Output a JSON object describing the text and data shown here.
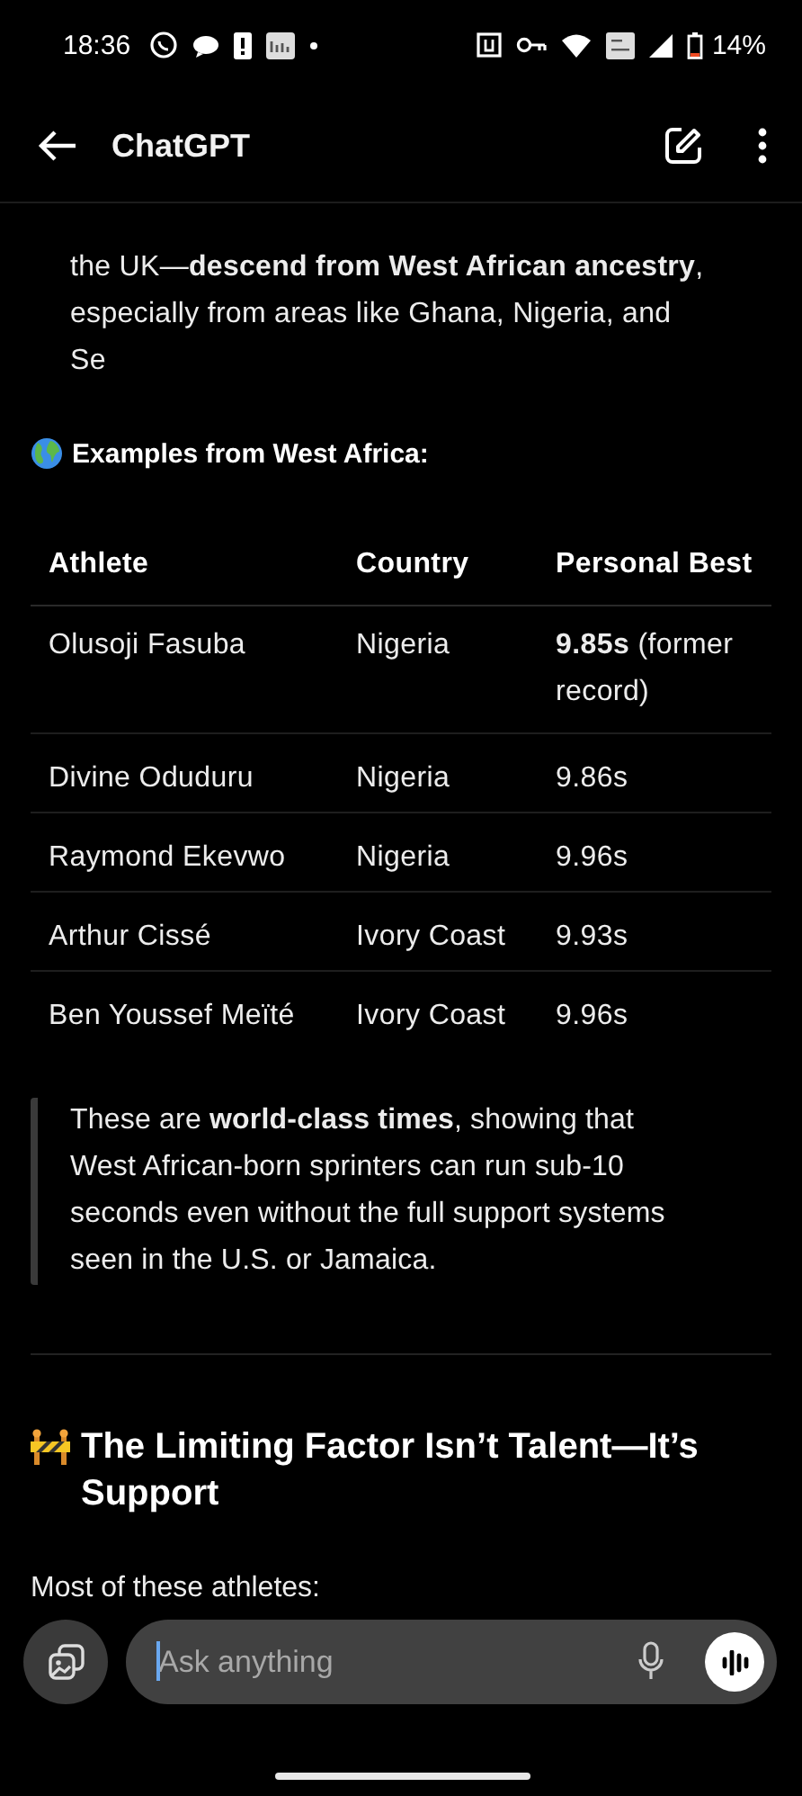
{
  "status_bar": {
    "time": "18:36",
    "battery": "14%"
  },
  "header": {
    "title": "ChatGPT"
  },
  "message": {
    "intro": "the UK—**descend from West African ancestry**,\nespecially from areas like Ghana, Nigeria, and\nSe",
    "section_heading": "Examples from West Africa:",
    "table": {
      "columns": [
        "Athlete",
        "Country",
        "Personal Best"
      ],
      "rows": [
        [
          "Olusoji Fasuba",
          "Nigeria",
          "**9.85s** (former\nrecord)"
        ],
        [
          "Divine Oduduru",
          "Nigeria",
          "9.86s"
        ],
        [
          "Raymond Ekevwo",
          "Nigeria",
          "9.96s"
        ],
        [
          "Arthur Cissé",
          "Ivory Coast",
          "9.93s"
        ],
        [
          "Ben Youssef Meïté",
          "Ivory Coast",
          "9.96s"
        ]
      ]
    },
    "callout": "These are **world-class times**, showing that\nWest African-born sprinters can run sub-10\nseconds even without the full support systems\nseen in the U.S. or Jamaica.",
    "heading": "The Limiting Factor Isn’t Talent—It’s\nSupport",
    "paragraph": "Most of these athletes:"
  },
  "composer": {
    "placeholder": "Ask anything"
  }
}
